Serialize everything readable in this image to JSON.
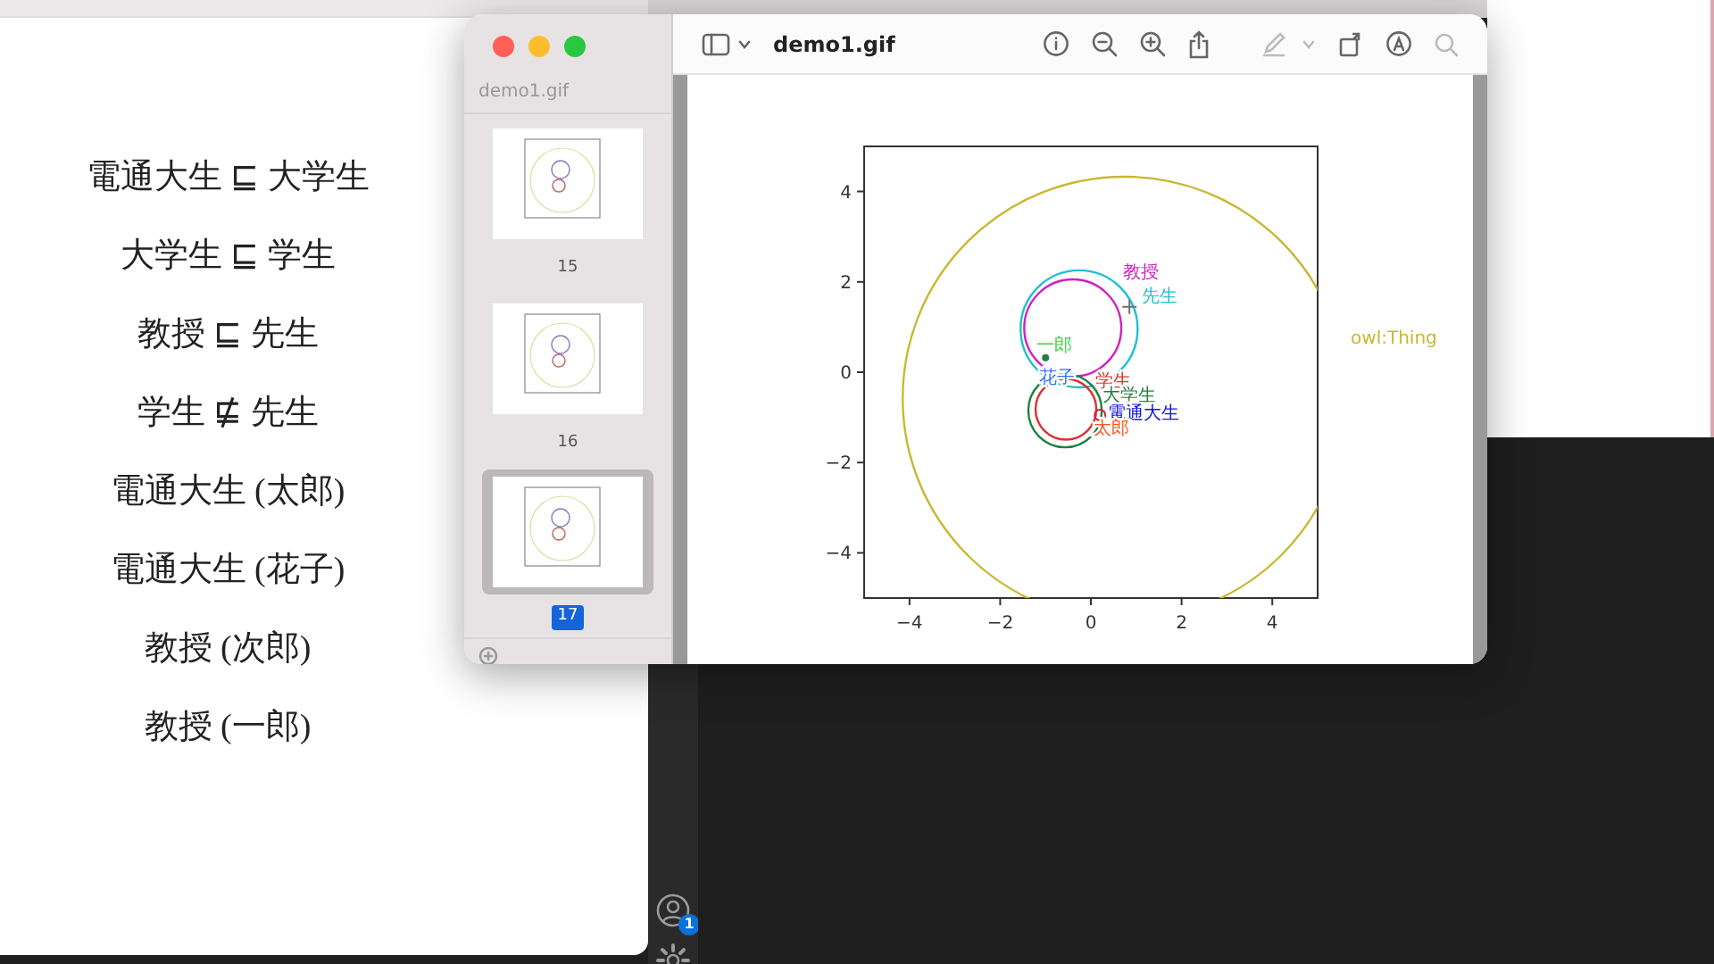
{
  "document": {
    "lines": [
      "電通大生 ⊑ 大学生",
      "大学生 ⊑ 学生",
      "教授 ⊑ 先生",
      "学生 ⋢ 先生",
      "電通大生 (太郎)",
      "電通大生 (花子)",
      "教授 (次郎)",
      "教授 (一郎)"
    ]
  },
  "preview_window": {
    "sidebar": {
      "file_name": "demo1.gif",
      "thumbnails": [
        {
          "label": "15",
          "selected": false
        },
        {
          "label": "16",
          "selected": false
        },
        {
          "label": "17",
          "selected": true
        }
      ]
    },
    "toolbar": {
      "title": "demo1.gif"
    },
    "image": {
      "chart_data": {
        "type": "scatter",
        "xlim": [
          -5,
          5
        ],
        "ylim": [
          -5,
          5
        ],
        "xticks": [
          -4,
          -2,
          0,
          2,
          4
        ],
        "yticks": [
          -4,
          -2,
          0,
          2,
          4
        ]
      },
      "circles": [
        {
          "color": "#c8b830"
        },
        {
          "color": "#20c0d0"
        },
        {
          "color": "#d020c0"
        },
        {
          "color": "#208040"
        },
        {
          "color": "#e03030"
        }
      ],
      "labels": [
        {
          "text": "教授",
          "color": "#d020c0"
        },
        {
          "text": "先生",
          "color": "#20c0d0"
        },
        {
          "text": "一郎",
          "color": "#40d040"
        },
        {
          "text": "花子",
          "color": "#3070ff"
        },
        {
          "text": "学生",
          "color": "#e03030"
        },
        {
          "text": "大学生",
          "color": "#208040"
        },
        {
          "text": "電通大生",
          "color": "#1010e0"
        },
        {
          "text": "太郎",
          "color": "#ff5020"
        },
        {
          "text": "owl:Thing",
          "color": "#c8b830"
        }
      ]
    }
  },
  "editor": {
    "activity_bar": [
      {
        "kind": "account",
        "badge": "1"
      },
      {
        "kind": "settings"
      }
    ]
  }
}
